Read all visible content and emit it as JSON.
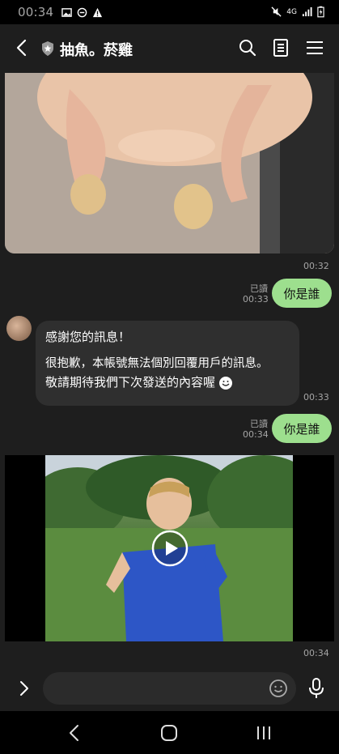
{
  "status_bar": {
    "time": "00:34",
    "network": "4G"
  },
  "header": {
    "title": "抽魚。菸雞"
  },
  "messages": {
    "time_1": "00:32",
    "out_1": {
      "read": "已讀",
      "time": "00:33",
      "text": "你是誰"
    },
    "in_1": {
      "line1": "感謝您的訊息！",
      "line2": "很抱歉，本帳號無法個別回覆用戶的訊息。",
      "line3": "敬請期待我們下次發送的內容喔",
      "time": "00:33"
    },
    "out_2": {
      "read": "已讀",
      "time": "00:34",
      "text": "你是誰"
    },
    "video_time": "00:34"
  },
  "colors": {
    "bubble_out": "#9ddf8e",
    "background": "#1e1e1e"
  },
  "icons": {
    "back": "chevron-left-icon",
    "search": "search-icon",
    "note": "notes-icon",
    "menu": "menu-icon",
    "emoji": "emoji-icon",
    "mic": "mic-icon",
    "play": "play-icon"
  }
}
